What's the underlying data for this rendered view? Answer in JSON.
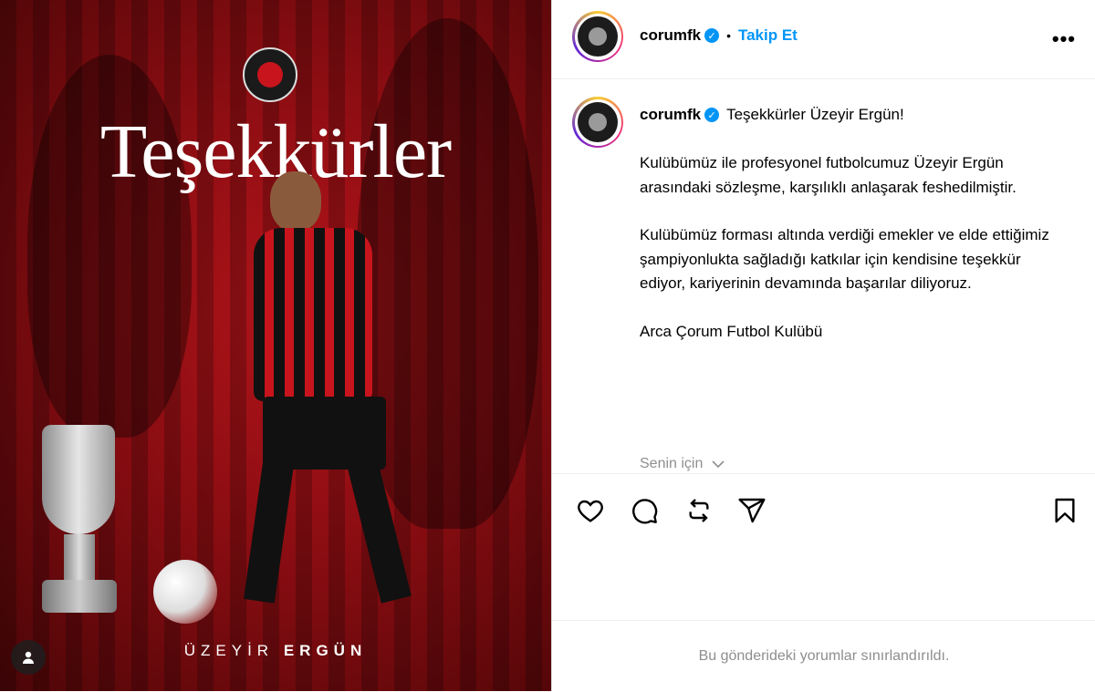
{
  "post_image": {
    "headline": "Teşekkürler",
    "player_first_name": "ÜZEYİR",
    "player_last_name": "ERGÜN"
  },
  "header": {
    "username": "corumfk",
    "separator": "•",
    "follow_label": "Takip Et",
    "more_label": "•••"
  },
  "caption": {
    "username": "corumfk",
    "title": "Teşekkürler Üzeyir Ergün!",
    "paragraphs": [
      "Kulübümüz ile profesyonel futbolcumuz Üzeyir Ergün arasındaki sözleşme, karşılıklı anlaşarak feshedilmiştir.",
      "Kulübümüz forması altında verdiği emekler ve elde ettiğimiz şampiyonlukta sağladığı katkılar için kendisine teşekkür ediyor, kariyerinin devamında başarılar diliyoruz.",
      "Arca Çorum Futbol Kulübü"
    ],
    "for_you_label": "Senin için"
  },
  "actions": {
    "icons": [
      "heart-icon",
      "comment-icon",
      "repost-icon",
      "share-icon",
      "bookmark-icon"
    ]
  },
  "footer": {
    "comments_notice": "Bu gönderideki yorumlar sınırlandırıldı."
  },
  "colors": {
    "accent": "#0095f6",
    "muted": "#8e8e8e",
    "image_red": "#b3141a"
  }
}
